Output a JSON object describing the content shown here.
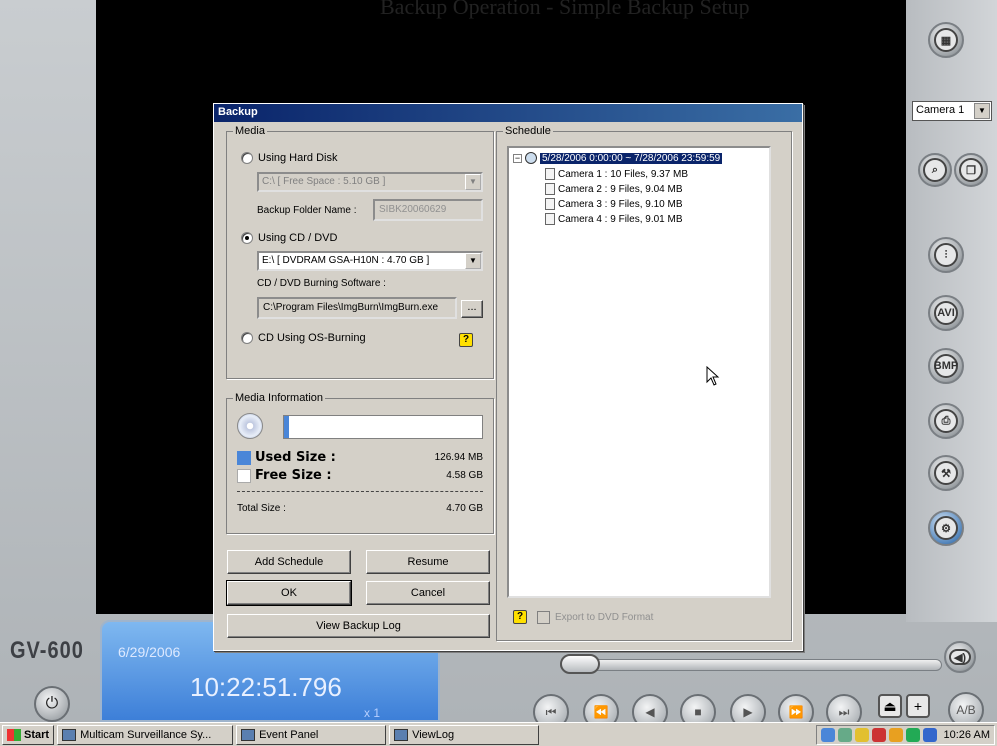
{
  "top_caption": "Backup Operation - Simple Backup Setup",
  "camera_selector": {
    "value": "Camera 1"
  },
  "clock": {
    "date": "6/29/2006",
    "time": "10:22:51.796",
    "rate": "x 1"
  },
  "logo": "GV-600",
  "dialog": {
    "title": "Backup",
    "media": {
      "group_label": "Media",
      "hard_disk_label": "Using Hard Disk",
      "hard_disk_value": "C:\\ [ Free Space : 5.10 GB ]",
      "folder_label": "Backup Folder Name :",
      "folder_value": "SIBK20060629",
      "cd_dvd_label": "Using CD / DVD",
      "cd_dvd_value": "E:\\ [ DVDRAM GSA-H10N : 4.70 GB ]",
      "software_label": "CD / DVD Burning Software :",
      "software_value": "C:\\Program Files\\ImgBurn\\ImgBurn.exe",
      "browse_label": "...",
      "os_burning_label": "CD Using OS-Burning",
      "help_label": "?"
    },
    "media_info": {
      "group_label": "Media Information",
      "used_label": "Used Size :",
      "used_value": "126.94 MB",
      "free_label": "Free Size :",
      "free_value": "4.58 GB",
      "total_label": "Total Size :",
      "total_value": "4.70 GB",
      "used_fraction": 0.027
    },
    "buttons": {
      "add_schedule": "Add Schedule",
      "resume": "Resume",
      "ok": "OK",
      "cancel": "Cancel",
      "view_log": "View Backup Log"
    },
    "schedule": {
      "group_label": "Schedule",
      "root": "5/28/2006 0:00:00 ~ 7/28/2006 23:59:59",
      "items": [
        "Camera 1 : 10 Files, 9.37 MB",
        "Camera 2 : 9 Files, 9.04 MB",
        "Camera 3 : 9 Files, 9.10 MB",
        "Camera 4 : 9 Files, 9.01 MB"
      ],
      "export_label": "Export to DVD Format",
      "help_label": "?"
    }
  },
  "taskbar": {
    "start": "Start",
    "tasks": [
      "Multicam Surveillance Sy...",
      "Event Panel",
      "ViewLog"
    ],
    "clock": "10:26 AM"
  },
  "colors": {
    "title_bar": "#0a246a",
    "used_color": "#4a86d8",
    "clock_panel": "#3d7fd8"
  }
}
